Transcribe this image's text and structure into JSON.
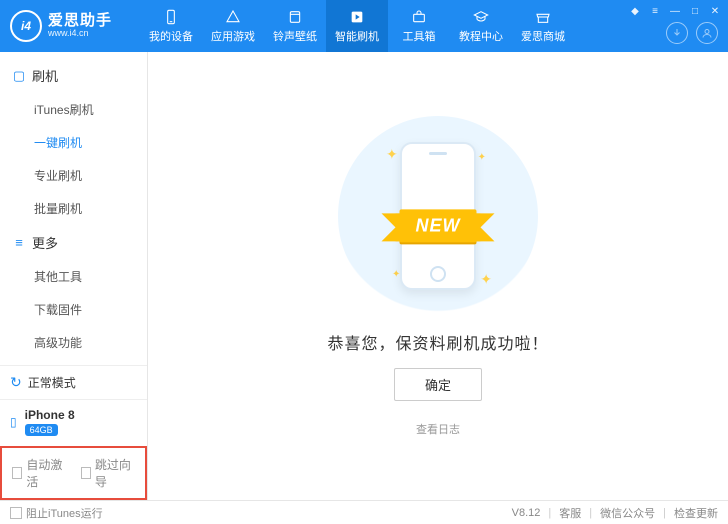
{
  "app": {
    "name": "爱思助手",
    "url": "www.i4.cn",
    "logo_text": "i4"
  },
  "nav": {
    "items": [
      {
        "label": "我的设备"
      },
      {
        "label": "应用游戏"
      },
      {
        "label": "铃声壁纸"
      },
      {
        "label": "智能刷机"
      },
      {
        "label": "工具箱"
      },
      {
        "label": "教程中心"
      },
      {
        "label": "爱思商城"
      }
    ]
  },
  "sidebar": {
    "groups": [
      {
        "title": "刷机",
        "items": [
          {
            "label": "iTunes刷机"
          },
          {
            "label": "一键刷机"
          },
          {
            "label": "专业刷机"
          },
          {
            "label": "批量刷机"
          }
        ]
      },
      {
        "title": "更多",
        "items": [
          {
            "label": "其他工具"
          },
          {
            "label": "下载固件"
          },
          {
            "label": "高级功能"
          }
        ]
      }
    ],
    "status": "正常模式",
    "device": {
      "name": "iPhone 8",
      "badge": "64GB"
    },
    "options": {
      "auto_activate": "自动激活",
      "skip_guide": "跳过向导"
    }
  },
  "content": {
    "ribbon": "NEW",
    "success_text": "恭喜您，保资料刷机成功啦！",
    "ok_button": "确定",
    "view_log": "查看日志"
  },
  "footer": {
    "block_itunes": "阻止iTunes运行",
    "version": "V8.12",
    "support": "客服",
    "wechat": "微信公众号",
    "update": "检查更新"
  }
}
